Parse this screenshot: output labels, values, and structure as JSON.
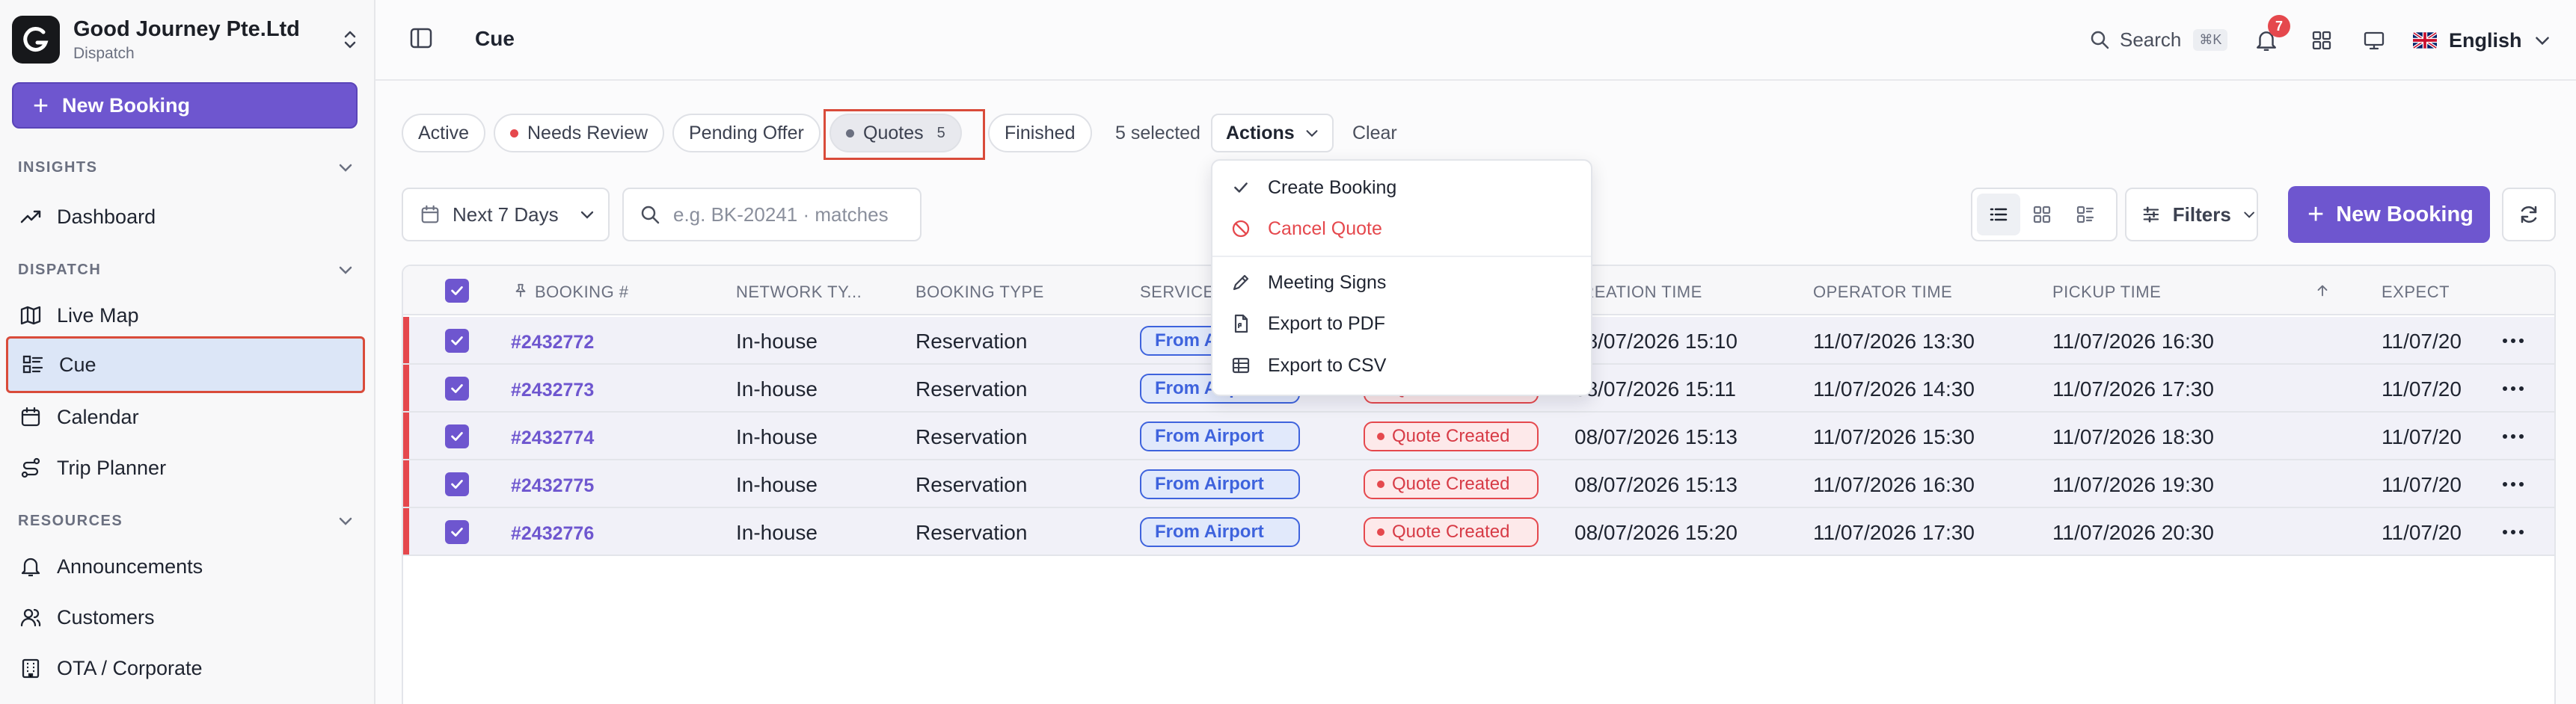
{
  "org": {
    "name": "Good Journey Pte.Ltd",
    "subtitle": "Dispatch"
  },
  "sidebar": {
    "new_booking_label": "New Booking",
    "sections": [
      {
        "title": "INSIGHTS",
        "items": [
          {
            "label": "Dashboard",
            "icon": "trend-icon"
          }
        ]
      },
      {
        "title": "DISPATCH",
        "items": [
          {
            "label": "Live Map",
            "icon": "map-icon"
          },
          {
            "label": "Cue",
            "icon": "list-icon",
            "active": true
          },
          {
            "label": "Calendar",
            "icon": "calendar-icon"
          },
          {
            "label": "Trip Planner",
            "icon": "route-icon"
          }
        ]
      },
      {
        "title": "RESOURCES",
        "items": [
          {
            "label": "Announcements",
            "icon": "bell-icon"
          },
          {
            "label": "Customers",
            "icon": "users-icon"
          },
          {
            "label": "OTA / Corporate",
            "icon": "building-icon"
          }
        ]
      }
    ]
  },
  "topbar": {
    "breadcrumb": "Cue",
    "search_label": "Search",
    "search_shortcut": "⌘K",
    "notification_count": "7",
    "language": "English"
  },
  "filters": {
    "chips": [
      {
        "label": "Active"
      },
      {
        "label": "Needs Review",
        "dot_color": "#e5484d"
      },
      {
        "label": "Pending Offer"
      },
      {
        "label": "Quotes",
        "count": "5",
        "dot_color": "#6b7080",
        "selected": true
      },
      {
        "label": "Finished"
      }
    ],
    "selected_text": "5 selected",
    "actions_label": "Actions",
    "clear_label": "Clear"
  },
  "toolbar": {
    "date_range": "Next 7 Days",
    "search_placeholder": "e.g. BK-20241 · matches",
    "filters_label": "Filters",
    "new_booking_label": "New Booking"
  },
  "actions_menu": {
    "items": [
      {
        "label": "Create Booking",
        "icon": "check-icon"
      },
      {
        "label": "Cancel Quote",
        "icon": "ban-icon",
        "danger": true
      },
      {
        "label": "Meeting Signs",
        "icon": "pen-icon"
      },
      {
        "label": "Export to PDF",
        "icon": "file-pdf-icon"
      },
      {
        "label": "Export to CSV",
        "icon": "table-csv-icon"
      }
    ]
  },
  "table": {
    "columns": [
      "BOOKING #",
      "NETWORK TY...",
      "BOOKING TYPE",
      "SERVICE",
      "CREATION TIME",
      "OPERATOR TIME",
      "PICKUP TIME",
      "EXPECTED"
    ],
    "rows": [
      {
        "id": "#2432772",
        "network": "In-house",
        "type": "Reservation",
        "service": "From Airport",
        "status": "Quote Created",
        "created": "08/07/2026 15:10",
        "operator": "11/07/2026 13:30",
        "pickup": "11/07/2026 16:30",
        "expected": "11/07/20"
      },
      {
        "id": "#2432773",
        "network": "In-house",
        "type": "Reservation",
        "service": "From Airport",
        "status": "Quote Created",
        "created": "08/07/2026 15:11",
        "operator": "11/07/2026 14:30",
        "pickup": "11/07/2026 17:30",
        "expected": "11/07/20"
      },
      {
        "id": "#2432774",
        "network": "In-house",
        "type": "Reservation",
        "service": "From Airport",
        "status": "Quote Created",
        "created": "08/07/2026 15:13",
        "operator": "11/07/2026 15:30",
        "pickup": "11/07/2026 18:30",
        "expected": "11/07/20"
      },
      {
        "id": "#2432775",
        "network": "In-house",
        "type": "Reservation",
        "service": "From Airport",
        "status": "Quote Created",
        "created": "08/07/2026 15:13",
        "operator": "11/07/2026 16:30",
        "pickup": "11/07/2026 19:30",
        "expected": "11/07/20"
      },
      {
        "id": "#2432776",
        "network": "In-house",
        "type": "Reservation",
        "service": "From Airport",
        "status": "Quote Created",
        "created": "08/07/2026 15:20",
        "operator": "11/07/2026 17:30",
        "pickup": "11/07/2026 20:30",
        "expected": "11/07/20"
      }
    ]
  },
  "colors": {
    "accent": "#6e56cf",
    "danger": "#e5484d",
    "service_blue": "#3e63dd",
    "highlight": "#d94b3a"
  }
}
